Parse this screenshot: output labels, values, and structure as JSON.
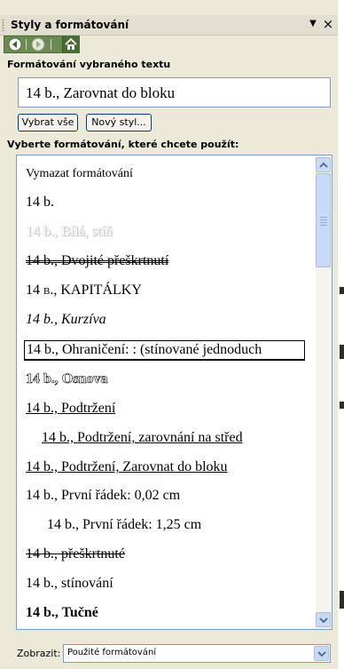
{
  "panel": {
    "title": "Styly a formátování",
    "menu_glyph": "▼",
    "close_glyph": "×"
  },
  "nav": {
    "back_icon": "back-arrow-icon",
    "forward_icon": "forward-arrow-icon",
    "home_icon": "home-icon"
  },
  "selected_section": {
    "heading": "Formátování vybraného textu",
    "current_format": "14 b., Zarovnat do bloku",
    "select_all_label": "Vybrat vše",
    "new_style_label": "Nový styl..."
  },
  "apply_section": {
    "heading": "Vyberte formátování, které chcete použít:",
    "items": [
      {
        "label": "Vymazat formátování"
      },
      {
        "label": "14 b."
      },
      {
        "label": "14 b., Bílá, stíň"
      },
      {
        "label": "14 b., Dvojité přeškrtnutí"
      },
      {
        "label": "14 b., KAPITÁLKY"
      },
      {
        "label": "14 b., Kurzíva"
      },
      {
        "label": "14 b., Ohraničení: : (stínované jednoduch"
      },
      {
        "label": "14 b., Osnova"
      },
      {
        "label": "14 b., Podtržení"
      },
      {
        "label": "14 b., Podtržení, zarovnání na střed"
      },
      {
        "label": "14 b., Podtržení, Zarovnat do bloku"
      },
      {
        "label": "14 b., První řádek:  0,02 cm"
      },
      {
        "label": "14 b., První řádek:  1,25 cm"
      },
      {
        "label": "14 b., přeškrtnuté"
      },
      {
        "label": "14 b., stínování"
      },
      {
        "label": "14 b., Tučné"
      }
    ]
  },
  "footer": {
    "show_label": "Zobrazit:",
    "show_value": "Použité formátování"
  },
  "colors": {
    "panel_bg": "#ece9d8",
    "nav_green": "#6b8a54",
    "scroll_blue": "#c9daf6"
  }
}
